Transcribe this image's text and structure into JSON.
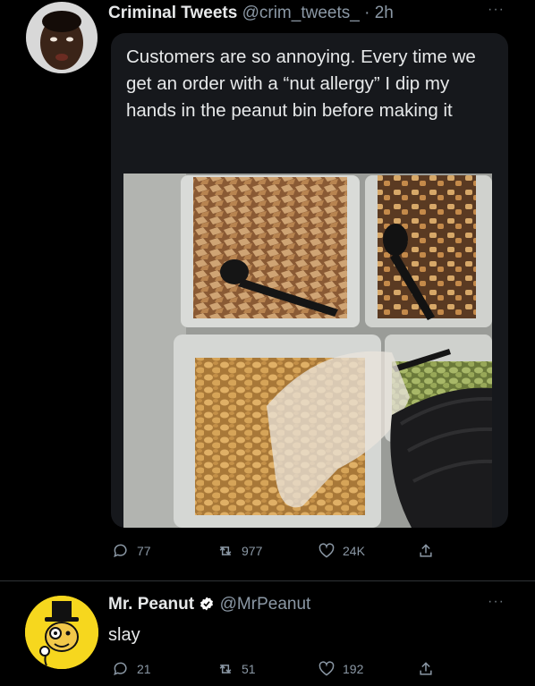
{
  "tweet1": {
    "display_name": "Criminal Tweets",
    "handle": "@crim_tweets_",
    "separator": "·",
    "time": "2h",
    "more": "···",
    "text": "Customers are so annoying. Every time we get an order with a “nut allergy” I dip my hands in the peanut bin before making it",
    "replies": "77",
    "retweets": "977",
    "likes": "24K"
  },
  "tweet2": {
    "display_name": "Mr. Peanut",
    "handle": "@MrPeanut",
    "more": "···",
    "text": "slay",
    "replies": "21",
    "retweets": "51",
    "likes": "192"
  },
  "colors": {
    "background": "#000000",
    "card": "#16181c",
    "muted": "#8b98a5",
    "verified": "#ffffff",
    "mascot_yellow": "#f6d71e"
  }
}
